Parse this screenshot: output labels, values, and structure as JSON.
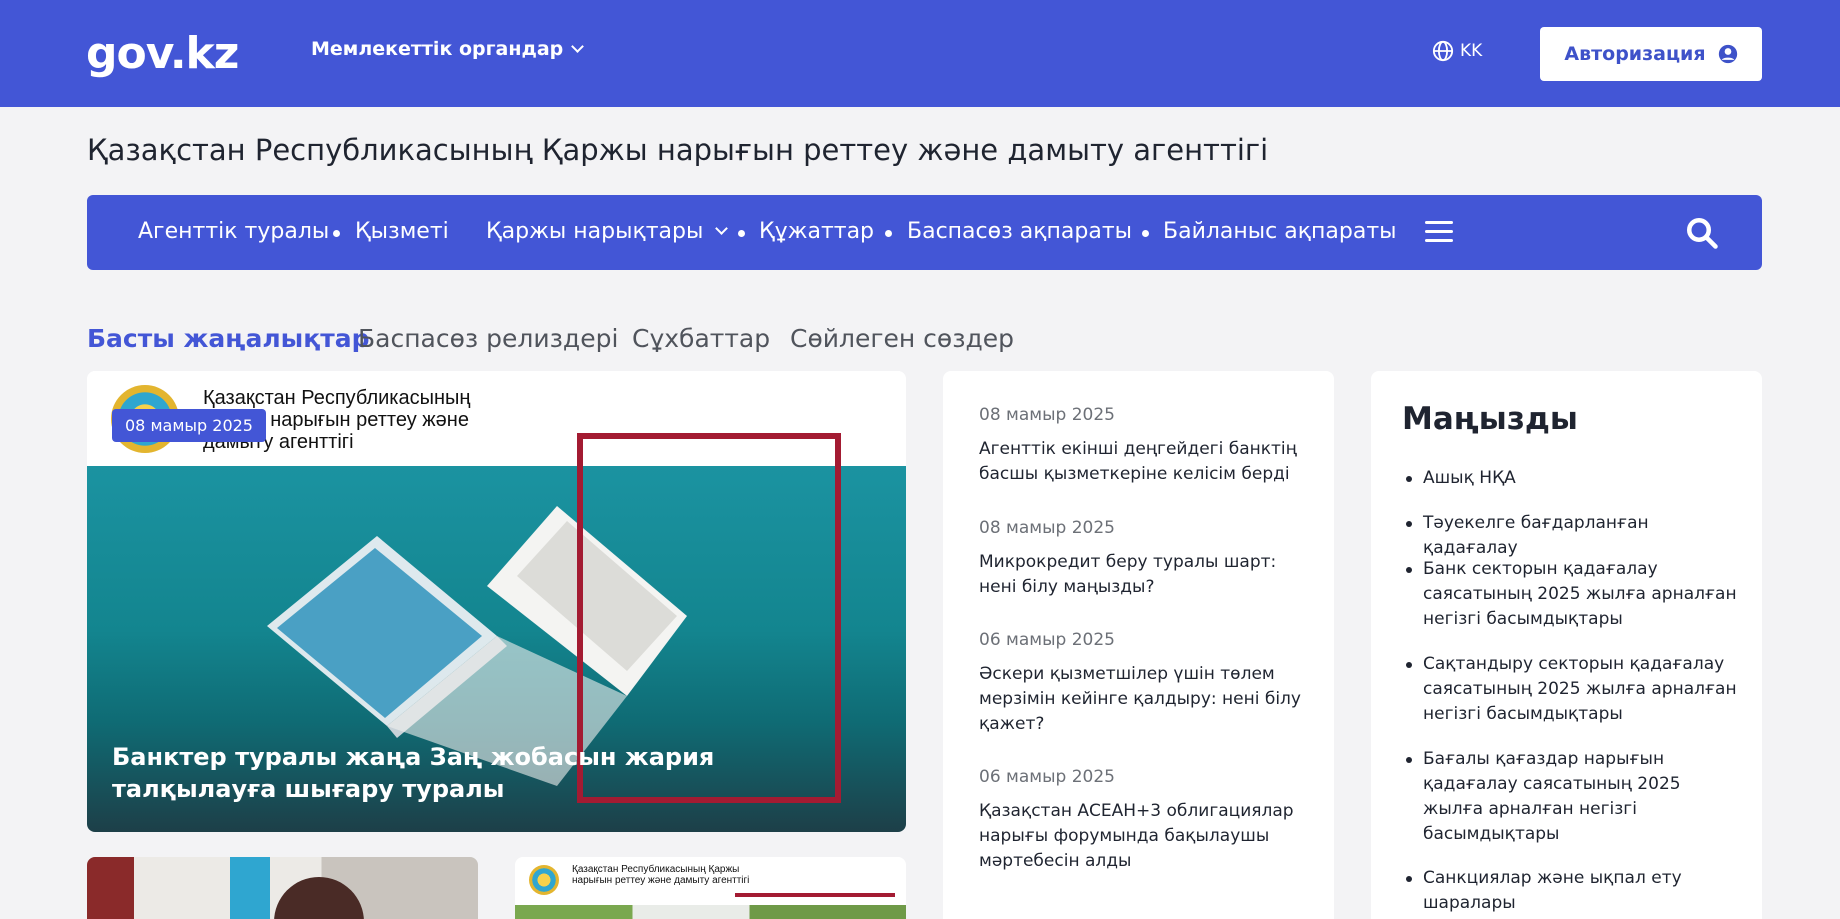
{
  "header": {
    "logo": "gov.kz",
    "gov_menu_label": "Мемлекеттік органдар",
    "language": "KK",
    "auth_label": "Авторизация"
  },
  "agency": {
    "title": "Қазақстан Республикасының Қаржы нарығын реттеу және дамыту агенттігі",
    "nav": [
      {
        "label": "Агенттік туралы"
      },
      {
        "label": "Қызметі"
      },
      {
        "label": "Қаржы нарықтары"
      },
      {
        "label": "Құжаттар"
      },
      {
        "label": "Баспасөз ақпараты"
      },
      {
        "label": "Байланыс ақпараты"
      }
    ]
  },
  "tabs": [
    {
      "label": "Басты жаңалықтар",
      "active": true
    },
    {
      "label": "Баспасөз релиздері",
      "active": false
    },
    {
      "label": "Сұхбаттар",
      "active": false
    },
    {
      "label": "Сөйлеген сөздер",
      "active": false
    }
  ],
  "featured": {
    "org_text": "Қазақстан Республикасының Қаржы нарығын реттеу және дамыту агенттігі",
    "date": "08 мамыр 2025",
    "title": "Банктер туралы жаңа Заң жобасын жария талқылауға шығару туралы"
  },
  "news": [
    {
      "date": "08 мамыр 2025",
      "title": "Агенттік екінші деңгейдегі банктің басшы қызметкеріне келісім берді"
    },
    {
      "date": "08 мамыр 2025",
      "title": "Микрокредит беру туралы шарт: нені білу маңызды?"
    },
    {
      "date": "06 мамыр 2025",
      "title": "Әскери қызметшілер үшін төлем мерзімін кейінге қалдыру: нені білу қажет?"
    },
    {
      "date": "06 мамыр 2025",
      "title": "Қазақстан АСЕАН+3 облигациялар нарығы форумында бақылаушы мәртебесін алды"
    }
  ],
  "important": {
    "title": "Маңызды",
    "items": [
      {
        "label": "Ашық НҚА"
      },
      {
        "label": "Тәуекелге бағдарланған қадағалау"
      },
      {
        "label": "Банк секторын қадағалау саясатының 2025 жылға арналған негізгі басымдықтары"
      },
      {
        "label": "Сақтандыру секторын қадағалау саясатының 2025 жылға арналған негізгі басымдықтары"
      },
      {
        "label": "Бағалы қағаздар нарығын қадағалау саясатының 2025 жылға арналған негізгі басымдықтары"
      },
      {
        "label": "Санкциялар және ықпал ету шаралары"
      }
    ]
  },
  "thumb2_text": "Қазақстан Республикасының Қаржы нарығын реттеу және дамыту агенттігі",
  "colors": {
    "brand": "#4356d6",
    "frame_red": "#a31b32",
    "background": "#f3f3f5"
  }
}
